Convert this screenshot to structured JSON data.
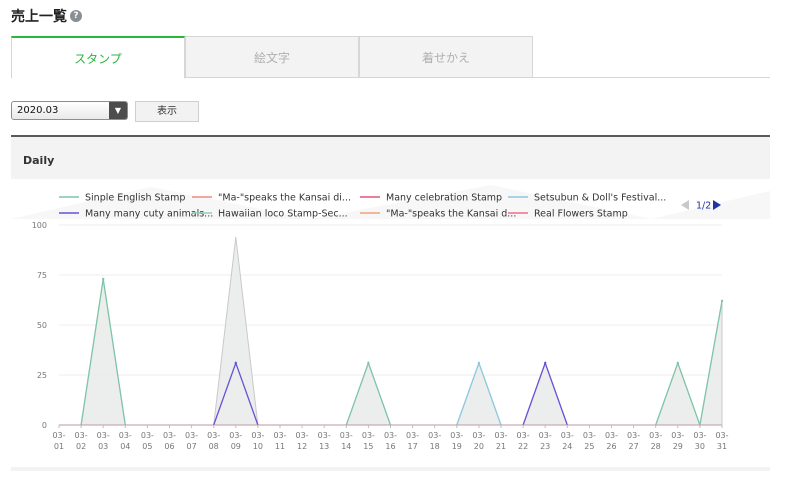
{
  "page": {
    "title": "売上一覧",
    "help_icon": "help-circle-icon",
    "help_glyph": "?"
  },
  "tabs": [
    {
      "label": "スタンプ",
      "active": true
    },
    {
      "label": "絵文字",
      "active": false
    },
    {
      "label": "着せかえ",
      "active": false
    }
  ],
  "controls": {
    "period_value": "2020.03",
    "show_label": "表示"
  },
  "panel": {
    "title": "Daily"
  },
  "legend": {
    "page": "1/2",
    "prev_icon": "triangle-left-icon",
    "next_icon": "triangle-right-icon"
  },
  "chart_data": {
    "type": "area",
    "title": "",
    "xlabel": "",
    "ylabel": "",
    "ylim": [
      0,
      100
    ],
    "yticks": [
      0,
      25,
      50,
      75,
      100
    ],
    "x": [
      "03-01",
      "03-02",
      "03-03",
      "03-04",
      "03-05",
      "03-06",
      "03-07",
      "03-08",
      "03-09",
      "03-10",
      "03-11",
      "03-12",
      "03-13",
      "03-14",
      "03-15",
      "03-16",
      "03-17",
      "03-18",
      "03-19",
      "03-20",
      "03-21",
      "03-22",
      "03-23",
      "03-24",
      "03-25",
      "03-26",
      "03-27",
      "03-28",
      "03-29",
      "03-30",
      "03-31"
    ],
    "grid": true,
    "legend_position": "top",
    "series": [
      {
        "name": "Sinple English Stamp",
        "color": "#7fc5a8",
        "values": [
          0,
          0,
          73,
          0,
          0,
          0,
          0,
          0,
          0,
          0,
          0,
          0,
          0,
          0,
          31,
          0,
          0,
          0,
          0,
          0,
          0,
          0,
          0,
          0,
          0,
          0,
          0,
          0,
          31,
          0,
          62
        ]
      },
      {
        "name": "\"Ma-\"speaks the Kansai di...",
        "color": "#f08a7e",
        "values": [
          0,
          0,
          0,
          0,
          0,
          0,
          0,
          0,
          0,
          0,
          0,
          0,
          0,
          0,
          0,
          0,
          0,
          0,
          0,
          0,
          0,
          0,
          0,
          0,
          0,
          0,
          0,
          0,
          0,
          0,
          0
        ]
      },
      {
        "name": "Many celebration Stamp",
        "color": "#e8507a",
        "values": [
          0,
          0,
          0,
          0,
          0,
          0,
          0,
          0,
          0,
          0,
          0,
          0,
          0,
          0,
          0,
          0,
          0,
          0,
          0,
          0,
          0,
          0,
          0,
          0,
          0,
          0,
          0,
          0,
          0,
          0,
          0
        ]
      },
      {
        "name": "Setsubun & Doll's Festival...",
        "color": "#8cc8e0",
        "values": [
          0,
          0,
          0,
          0,
          0,
          0,
          0,
          0,
          0,
          0,
          0,
          0,
          0,
          0,
          0,
          0,
          0,
          0,
          0,
          31,
          0,
          0,
          0,
          0,
          0,
          0,
          0,
          0,
          0,
          0,
          0
        ]
      },
      {
        "name": "Many many cuty animals...",
        "color": "#6a4fd6",
        "values": [
          0,
          0,
          0,
          0,
          0,
          0,
          0,
          0,
          31,
          0,
          0,
          0,
          0,
          0,
          0,
          0,
          0,
          0,
          0,
          0,
          0,
          0,
          31,
          0,
          0,
          0,
          0,
          0,
          0,
          0,
          0
        ]
      },
      {
        "name": "Hawaiian loco Stamp-Sec...",
        "color": "#8fd0b8",
        "values": [
          0,
          0,
          0,
          0,
          0,
          0,
          0,
          0,
          0,
          0,
          0,
          0,
          0,
          0,
          0,
          0,
          0,
          0,
          0,
          0,
          0,
          0,
          0,
          0,
          0,
          0,
          0,
          0,
          0,
          0,
          0
        ]
      },
      {
        "name": "\"Ma-\"speaks the Kansai d...",
        "color": "#f3a07a",
        "values": [
          0,
          0,
          0,
          0,
          0,
          0,
          0,
          0,
          0,
          0,
          0,
          0,
          0,
          0,
          0,
          0,
          0,
          0,
          0,
          0,
          0,
          0,
          0,
          0,
          0,
          0,
          0,
          0,
          0,
          0,
          0
        ]
      },
      {
        "name": "Real Flowers Stamp",
        "color": "#ef6f8a",
        "values": [
          0,
          0,
          0,
          0,
          0,
          0,
          0,
          0,
          0,
          0,
          0,
          0,
          0,
          0,
          0,
          0,
          0,
          0,
          0,
          0,
          0,
          0,
          0,
          0,
          0,
          0,
          0,
          0,
          0,
          0,
          0
        ]
      }
    ],
    "total": {
      "color": "#c9c9c9",
      "values": [
        0,
        0,
        73,
        0,
        0,
        0,
        0,
        0,
        94,
        0,
        0,
        0,
        0,
        0,
        31,
        0,
        0,
        0,
        0,
        31,
        0,
        0,
        31,
        0,
        0,
        0,
        0,
        0,
        31,
        0,
        62
      ]
    }
  }
}
